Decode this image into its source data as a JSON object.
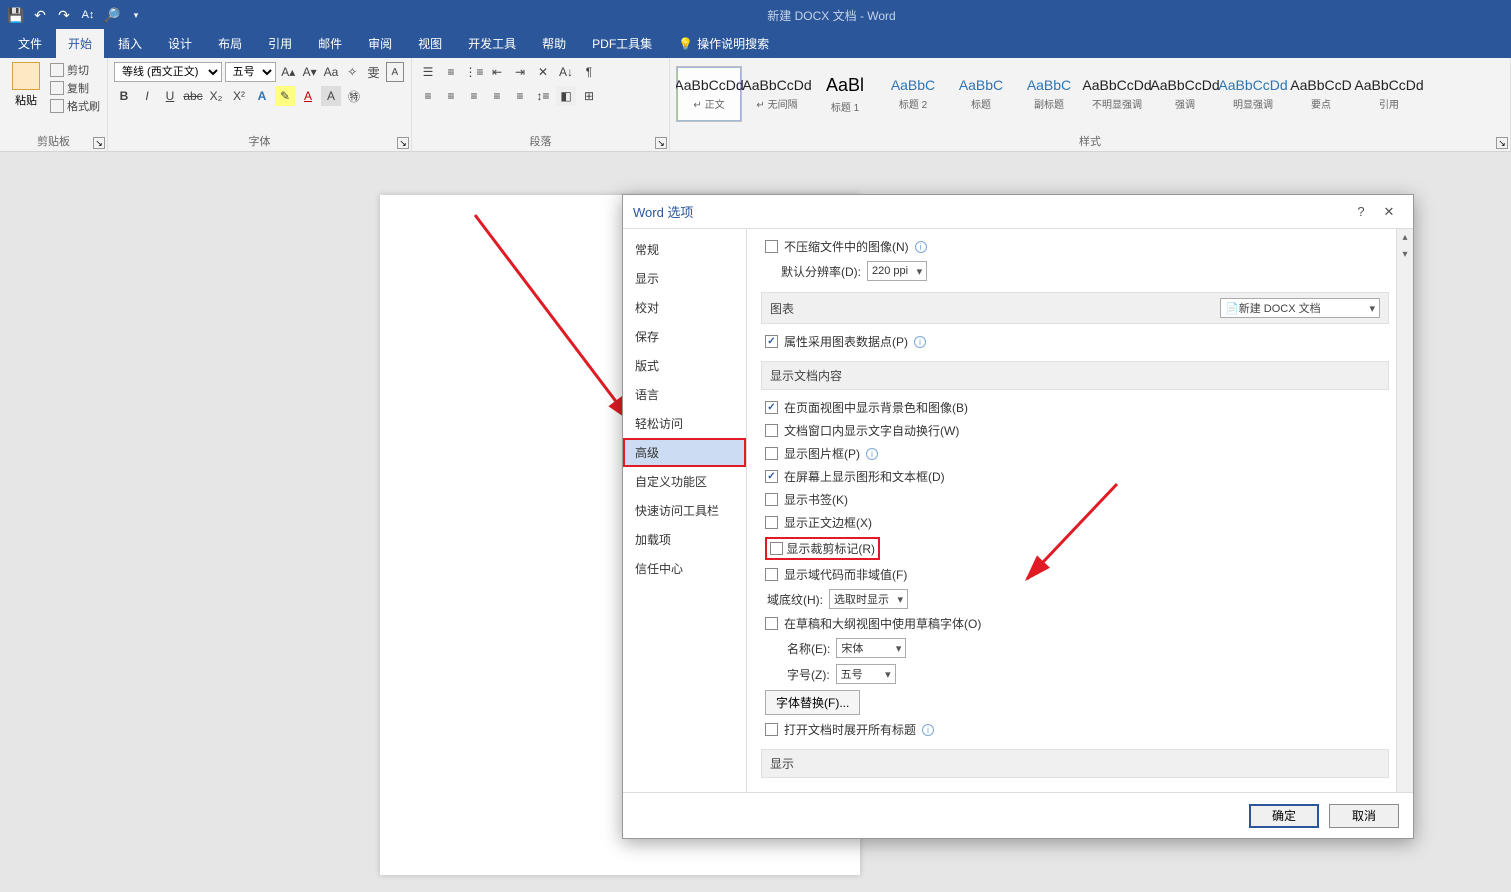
{
  "title": "新建 DOCX 文档 - Word",
  "tabs": [
    "文件",
    "开始",
    "插入",
    "设计",
    "布局",
    "引用",
    "邮件",
    "审阅",
    "视图",
    "开发工具",
    "帮助",
    "PDF工具集"
  ],
  "tellme": "操作说明搜索",
  "clipboard": {
    "paste": "粘贴",
    "cut": "剪切",
    "copy": "复制",
    "format_painter": "格式刷",
    "group": "剪贴板"
  },
  "font": {
    "name": "等线 (西文正文)",
    "size": "五号",
    "group": "字体"
  },
  "para": {
    "group": "段落"
  },
  "styles_group": "样式",
  "styles": [
    {
      "preview": "AaBbCcDd",
      "name": "↵ 正文",
      "sel": true
    },
    {
      "preview": "AaBbCcDd",
      "name": "↵ 无间隔"
    },
    {
      "preview": "AaBl",
      "name": "标题 1",
      "cls": "big"
    },
    {
      "preview": "AaBbC",
      "name": "标题 2",
      "cls": "blue"
    },
    {
      "preview": "AaBbC",
      "name": "标题",
      "cls": "blue"
    },
    {
      "preview": "AaBbC",
      "name": "副标题",
      "cls": "blue"
    },
    {
      "preview": "AaBbCcDd",
      "name": "不明显强调"
    },
    {
      "preview": "AaBbCcDd",
      "name": "强调"
    },
    {
      "preview": "AaBbCcDd",
      "name": "明显强调",
      "cls": "blue"
    },
    {
      "preview": "AaBbCcD",
      "name": "要点"
    },
    {
      "preview": "AaBbCcDd",
      "name": "引用"
    }
  ],
  "dialog": {
    "title": "Word 选项",
    "nav": [
      "常规",
      "显示",
      "校对",
      "保存",
      "版式",
      "语言",
      "轻松访问",
      "高级",
      "自定义功能区",
      "快速访问工具栏",
      "加载项",
      "信任中心"
    ],
    "nav_hl": "高级",
    "opt_nocompress": "不压缩文件中的图像(N)",
    "lbl_defaultres": "默认分辨率(D):",
    "val_defaultres": "220 ppi",
    "sec_chart": "图表",
    "ddl_chart_doc": "新建 DOCX 文档",
    "opt_chart_datapoint": "属性采用图表数据点(P)",
    "sec_showdoc": "显示文档内容",
    "opt_bgimg": "在页面视图中显示背景色和图像(B)",
    "opt_wrap": "文档窗口内显示文字自动换行(W)",
    "opt_picframe": "显示图片框(P)",
    "opt_drawings": "在屏幕上显示图形和文本框(D)",
    "opt_bookmarks": "显示书签(K)",
    "opt_textbounds": "显示正文边框(X)",
    "opt_cropmarks": "显示裁剪标记(R)",
    "opt_fieldcodes": "显示域代码而非域值(F)",
    "lbl_fieldshade": "域底纹(H):",
    "val_fieldshade": "选取时显示",
    "opt_draftfont": "在草稿和大纲视图中使用草稿字体(O)",
    "lbl_fontname": "名称(E):",
    "val_fontname": "宋体",
    "lbl_fontsize": "字号(Z):",
    "val_fontsize": "五号",
    "btn_fontsub": "字体替换(F)...",
    "opt_expandheadings": "打开文档时展开所有标题",
    "sec_display": "显示",
    "btn_ok": "确定",
    "btn_cancel": "取消"
  }
}
